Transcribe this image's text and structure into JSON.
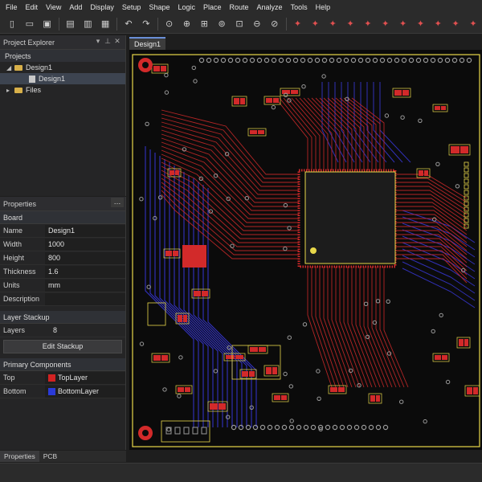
{
  "menu": [
    "File",
    "Edit",
    "View",
    "Add",
    "Display",
    "Setup",
    "Shape",
    "Logic",
    "Place",
    "Route",
    "Analyze",
    "Tools",
    "Help"
  ],
  "toolbar": {
    "groups": [
      [
        "new-file-icon",
        "open-folder-icon",
        "save-icon"
      ],
      [
        "print-icon",
        "export-icon",
        "layout-icon"
      ],
      [
        "undo-icon",
        "redo-icon"
      ],
      [
        "zoom-fit-icon",
        "zoom-in-icon",
        "zoom-box-icon",
        "zoom-center-icon",
        "zoom-area-icon",
        "zoom-out-icon",
        "zoom-previous-icon"
      ],
      [
        "route-icon",
        "route-star-icon",
        "route-cross-icon",
        "route-diff-icon",
        "route-fanout-icon",
        "route-bus-icon",
        "route-push-icon",
        "route-glue-icon",
        "route-slide-icon",
        "route-tune-icon",
        "route-length-icon"
      ]
    ]
  },
  "explorer": {
    "title": "Project Explorer",
    "section": "Projects",
    "tree": [
      {
        "label": "Design1",
        "level": 1,
        "icon": "folder-icon",
        "expanded": true,
        "selected": false
      },
      {
        "label": "Design1",
        "level": 2,
        "icon": "design-file-icon",
        "expanded": false,
        "selected": true
      },
      {
        "label": "Files",
        "level": 1,
        "icon": "folder-icon",
        "expanded": false,
        "selected": false
      }
    ]
  },
  "properties": {
    "title": "Properties",
    "board": {
      "title": "Board",
      "rows": [
        {
          "key": "Name",
          "value": "Design1"
        },
        {
          "key": "Width",
          "value": "1000"
        },
        {
          "key": "Height",
          "value": "800"
        },
        {
          "key": "Thickness",
          "value": "1.6"
        },
        {
          "key": "Units",
          "value": "mm"
        },
        {
          "key": "Description",
          "value": ""
        }
      ]
    },
    "stackup": {
      "title": "Layer Stackup",
      "layers_label": "Layers",
      "layers_value": "8",
      "button": "Edit Stackup"
    },
    "components": {
      "title": "Primary Components",
      "rows": [
        {
          "key": "Top",
          "value": "TopLayer",
          "color": "#d22222"
        },
        {
          "key": "Bottom",
          "value": "BottomLayer",
          "color": "#2a3ad8"
        }
      ]
    }
  },
  "bottom_tabs": [
    "Properties",
    "PCB"
  ],
  "document_tab": "Design1",
  "colors": {
    "board_background": "#0b0b0b",
    "top_copper": "#d22a2a",
    "bottom_copper": "#3a3ae0",
    "silkscreen": "#e8d84a",
    "pad": "#9a9a9a"
  }
}
